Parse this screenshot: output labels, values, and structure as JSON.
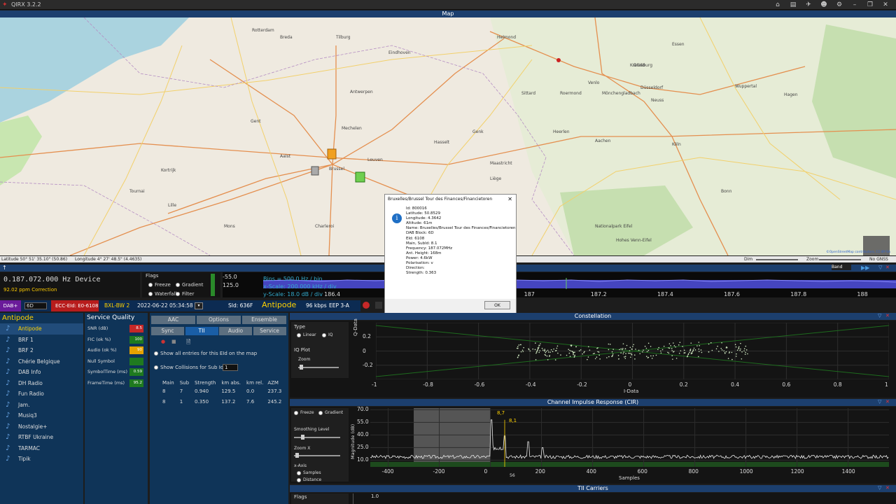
{
  "app": {
    "title": "QIRX 3.2.2"
  },
  "map": {
    "title": "Map",
    "coords": "Latitude  50° 51' 35.10\" (50.86)",
    "lon": "Longitude  4° 27' 48.5\" (4.4635)",
    "dim": "Dim",
    "zoom": "Zoom",
    "gnss": "No GNSS",
    "labels": [
      "Antwerpen",
      "Mechelen",
      "Brussel",
      "Gent",
      "Leuven",
      "Liège",
      "Maastricht",
      "Aachen",
      "Köln",
      "Düsseldorf",
      "Duisburg",
      "Essen",
      "Eindhoven",
      "Helmond",
      "Venlo",
      "Mönchengladbach",
      "Rotterdam",
      "Tilburg",
      "Lille",
      "Namur",
      "Charleroi",
      "Mons",
      "Bonn",
      "Hasselt",
      "Genk",
      "Sittard",
      "Wuppertal",
      "Hagen",
      "Neuss",
      "Tournai",
      "Aalst",
      "Kortrijk",
      "Breda",
      "Roermond",
      "Heerlen",
      "Krefeld",
      "Nationalpark Eifel",
      "Hohes Venn-Eifel"
    ],
    "attrib": "©OpenStreetMap contributors, CC-BY-SA"
  },
  "device": {
    "freq": "0.187.072.000 Hz Device",
    "ppm": "92.02 ppm Correction",
    "flags": "Flags",
    "freeze": "Freeze",
    "gradient": "Gradient",
    "waterfall": "Waterfall",
    "filter": "Filter",
    "spec_scale": "Bins = 500.0 Hz / bin",
    "xscale": "x-Scale: 200.000 kHz / div",
    "yscale": "y-Scale: 18.0 dB / div",
    "db1": "-55.0",
    "db2": "125.0",
    "spec_ticks": [
      "186.4",
      "186.6",
      "186.8",
      "187",
      "187.2",
      "187.4",
      "187.6",
      "187.8",
      "188"
    ]
  },
  "dab": {
    "mode": "DAB+",
    "chan": "6D",
    "ecc": "ECC-EId: E0-6108",
    "mux": "BXL-BW 2",
    "datetime": "2022-06-22  05:34:58",
    "sid": "SId: 636F",
    "service": "Antipode",
    "rate": "96 kbps",
    "eep": "EEP 3-A",
    "band_select": "Band"
  },
  "stations": {
    "header": "Antipode",
    "items": [
      "Antipode",
      "BRF 1",
      "BRF 2",
      "Chérie Belgique",
      "DAB Info",
      "DH Radio",
      "Fun Radio",
      "Jam.",
      "Musiq3",
      "Nostalgie+",
      "RTBF Ukraine",
      "TARMAC",
      "Tipik"
    ]
  },
  "quality": {
    "header": "Service Quality",
    "rows": [
      {
        "label": "SNR (dB)",
        "val": "8.5",
        "color": "#c62828"
      },
      {
        "label": "FIC (ok %)",
        "val": "100",
        "color": "#1f7a1f"
      },
      {
        "label": "Audio (ok %)",
        "val": "90",
        "color": "#e6a200"
      },
      {
        "label": "Null Symbol",
        "val": "",
        "color": "#1f7a1f"
      },
      {
        "label": "SymbolTime (ms)",
        "val": "0.59",
        "color": "#1f7a1f"
      },
      {
        "label": "FrameTime (ms)",
        "val": "95.2",
        "color": "#1f7a1f"
      }
    ]
  },
  "tabs": {
    "row1": [
      "AAC",
      "Options",
      "Ensemble"
    ],
    "row2": [
      "Sync",
      "TII",
      "Audio",
      "Service"
    ],
    "show_all": "Show all entries for this EId on the map",
    "show_coll": "Show Collisions for Sub Id",
    "sub_val": "1",
    "cols": [
      "Main",
      "Sub",
      "Strength",
      "km abs.",
      "km rel.",
      "AZM"
    ],
    "rows": [
      [
        "8",
        "7",
        "0.940",
        "129.5",
        "0.0",
        "237.3"
      ],
      [
        "8",
        "1",
        "0.350",
        "137.2",
        "7.6",
        "245.2"
      ]
    ]
  },
  "dialog": {
    "title": "Bruxelles/Brussel Tour des Finances/Financietoren",
    "lines": [
      "Id: 800016",
      "Latitude: 50.8529",
      "Longitude: 4.3642",
      "Altitude: 61m",
      "Name: Bruxelles/Brussel Tour des Finances/Financietoren",
      "DAB Block: 6D",
      "EId: 6108",
      "Main, SubId: 8.1",
      "Frequency: 187.072MHz",
      "Ant. Height: 168m",
      "Power: 4.6kW",
      "Polarisation: v",
      "Direction:",
      "Strength: 0.363"
    ],
    "ok": "OK"
  },
  "constellation": {
    "title": "Constellation",
    "type": "Type",
    "linear": "Linear",
    "iq": "IQ",
    "iqplot": "IQ Plot",
    "zoom": "Zoom",
    "ylabel": "Q-Data",
    "xlabel": "I-Data",
    "yticks": [
      "0.2",
      "0",
      "-0.2"
    ],
    "xticks": [
      "-1",
      "-0.8",
      "-0.6",
      "-0.4",
      "-0.2",
      "0",
      "0.2",
      "0.4",
      "0.6",
      "0.8",
      "1"
    ]
  },
  "cir": {
    "title": "Channel Impulse Response (CIR)",
    "freeze": "Freeze",
    "gradient": "Gradient",
    "smoothing": "Smoothing Level",
    "zoomx": "Zoom X",
    "xaxis": "x-Axis",
    "samples": "Samples",
    "distance": "Distance",
    "ylabel": "Magnitude (dB)",
    "xlabel": "Samples",
    "yticks": [
      "70.0",
      "55.0",
      "40.0",
      "25.0",
      "10.0"
    ],
    "xticks": [
      "-400",
      "-200",
      "0",
      "200",
      "400",
      "600",
      "800",
      "1000",
      "1200",
      "1400"
    ],
    "peak1": "8,7",
    "peak2": "8,1",
    "marker": "56"
  },
  "tii": {
    "title": "TII Carriers",
    "flags": "Flags",
    "ytick": "1.0"
  },
  "colors": {
    "accent": "#1c3f6e",
    "selected": "#ffd200",
    "spectrum": "#4a4ac8"
  }
}
